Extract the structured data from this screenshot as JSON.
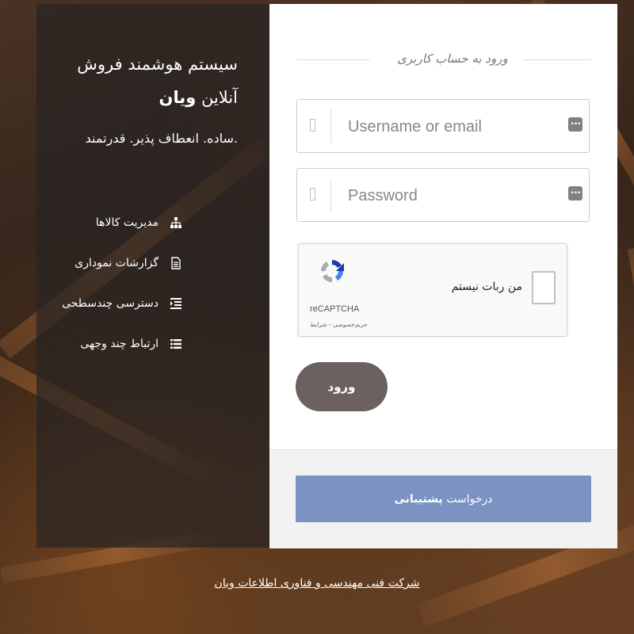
{
  "brand": {
    "title_line1": "سیستم هوشمند فروش",
    "title_line2_prefix": "آنلاین",
    "title_line2_bold": "ویان",
    "tagline": ".ساده. انعطاف پذیر. قدرتمند"
  },
  "features": [
    {
      "label": "مدیریت کالاها",
      "icon": "sitemap-icon"
    },
    {
      "label": "گزارشات نموداری",
      "icon": "document-icon"
    },
    {
      "label": "دسترسی چندسطحی",
      "icon": "indent-list-icon"
    },
    {
      "label": "ارتباط چند وجهی",
      "icon": "list-icon"
    }
  ],
  "login": {
    "heading": "ورود به حساب کاربری",
    "username_placeholder": "Username or email",
    "password_placeholder": "Password",
    "submit_label": "ورود"
  },
  "captcha": {
    "checkbox_label": "من ربات نیستم",
    "brand": "reCAPTCHA",
    "terms": "حریم‌خصوصی - شرایط"
  },
  "support": {
    "prefix": "درخواست",
    "bold": "پشتیبانی"
  },
  "footer": {
    "company_link": "شرکت فنی مهندسی و فناوری اطلاعات ویان"
  },
  "colors": {
    "login_button": "#6b615e",
    "support_button": "#7b93c2",
    "panel_overlay": "#28241f"
  }
}
